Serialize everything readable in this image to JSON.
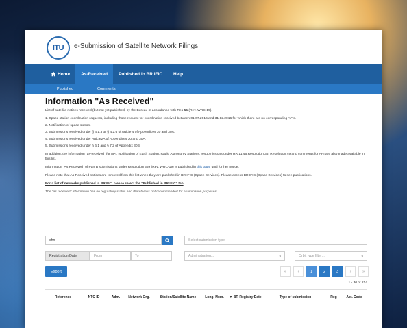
{
  "header": {
    "logo_text": "ITU",
    "site_title": "e-Submission of Satellite Network Filings"
  },
  "nav": {
    "items": [
      "Home",
      "As-Received",
      "Published in BR IFIC",
      "Help"
    ]
  },
  "subnav": {
    "items": [
      "Published",
      "Comments"
    ]
  },
  "content": {
    "title": "Information \"As Received\"",
    "intro_prefix": "List of satellite notices received (but not yet published) by the Bureau in accordance with Res ",
    "intro_bold": "55",
    "intro_suffix": " (Rev. WRC-19).",
    "list": [
      "1. Space station coordination requests, including those request for coordination received between 01.07.2016 and 31.12.2016 for which there are no corresponding APIs.",
      "2. Notification of space station.",
      "3. Submissions received under § 4.1.3 or § 4.2.6 of Article 4 of Appendices 30 and 30A.",
      "4. Submissions received under Article2A of Appendices 30 and 30A.",
      "5. Submissions received under § 6.1 and § 7.2 of Appendix 30B."
    ],
    "para_addition": "In addition, the information \"as-received\" for API, Notification of Earth Station, Radio Astronomy Stations, resubmissions under RR 11.46,Resolution 35, Resolution 49 and comments for API are also made available in this list.",
    "para_partb_prefix": "Information \"As Received\" of Part B submissions under Resolution 559 (Rev. WRC-19) is published in ",
    "para_partb_link": "this page",
    "para_partb_suffix": " until further notice.",
    "para_note": "Please note that As-Received notices are removed from this list when they are published in BR IFIC (Space Services). Please access BR IFIC (Space Services) to see publications.",
    "para_list_link": "For a list of networks published in BRIFIC, please select the \"Published in BR IFIC\" tab",
    "para_disclaimer": "The \"as received\" information has no regulatory status and therefore is not recommended for examination purposes."
  },
  "filters": {
    "search_value": "chn",
    "submission_type_placeholder": "Select submission type",
    "registration_date_label": "Registration Date",
    "from_placeholder": "From",
    "to_placeholder": "To",
    "administration_placeholder": "Administration...",
    "orbit_type_placeholder": "Orbit type filter..."
  },
  "actions": {
    "export_label": "Export"
  },
  "pager": {
    "items": [
      "«",
      "‹",
      "1",
      "2",
      "3",
      "›",
      "»"
    ],
    "current_page": "1",
    "count_text": "1 - 30 of 214"
  },
  "table": {
    "columns": [
      "Reference",
      "NTC ID",
      "Adm.",
      "Network Org.",
      "Station/Satellite Name",
      "Long. Nom.",
      "▼ BR Registry Date",
      "Type of submission",
      "Reg",
      "Act. Code"
    ]
  },
  "colors": {
    "nav_bg": "#1f5f9f",
    "accent": "#2a78c4"
  }
}
